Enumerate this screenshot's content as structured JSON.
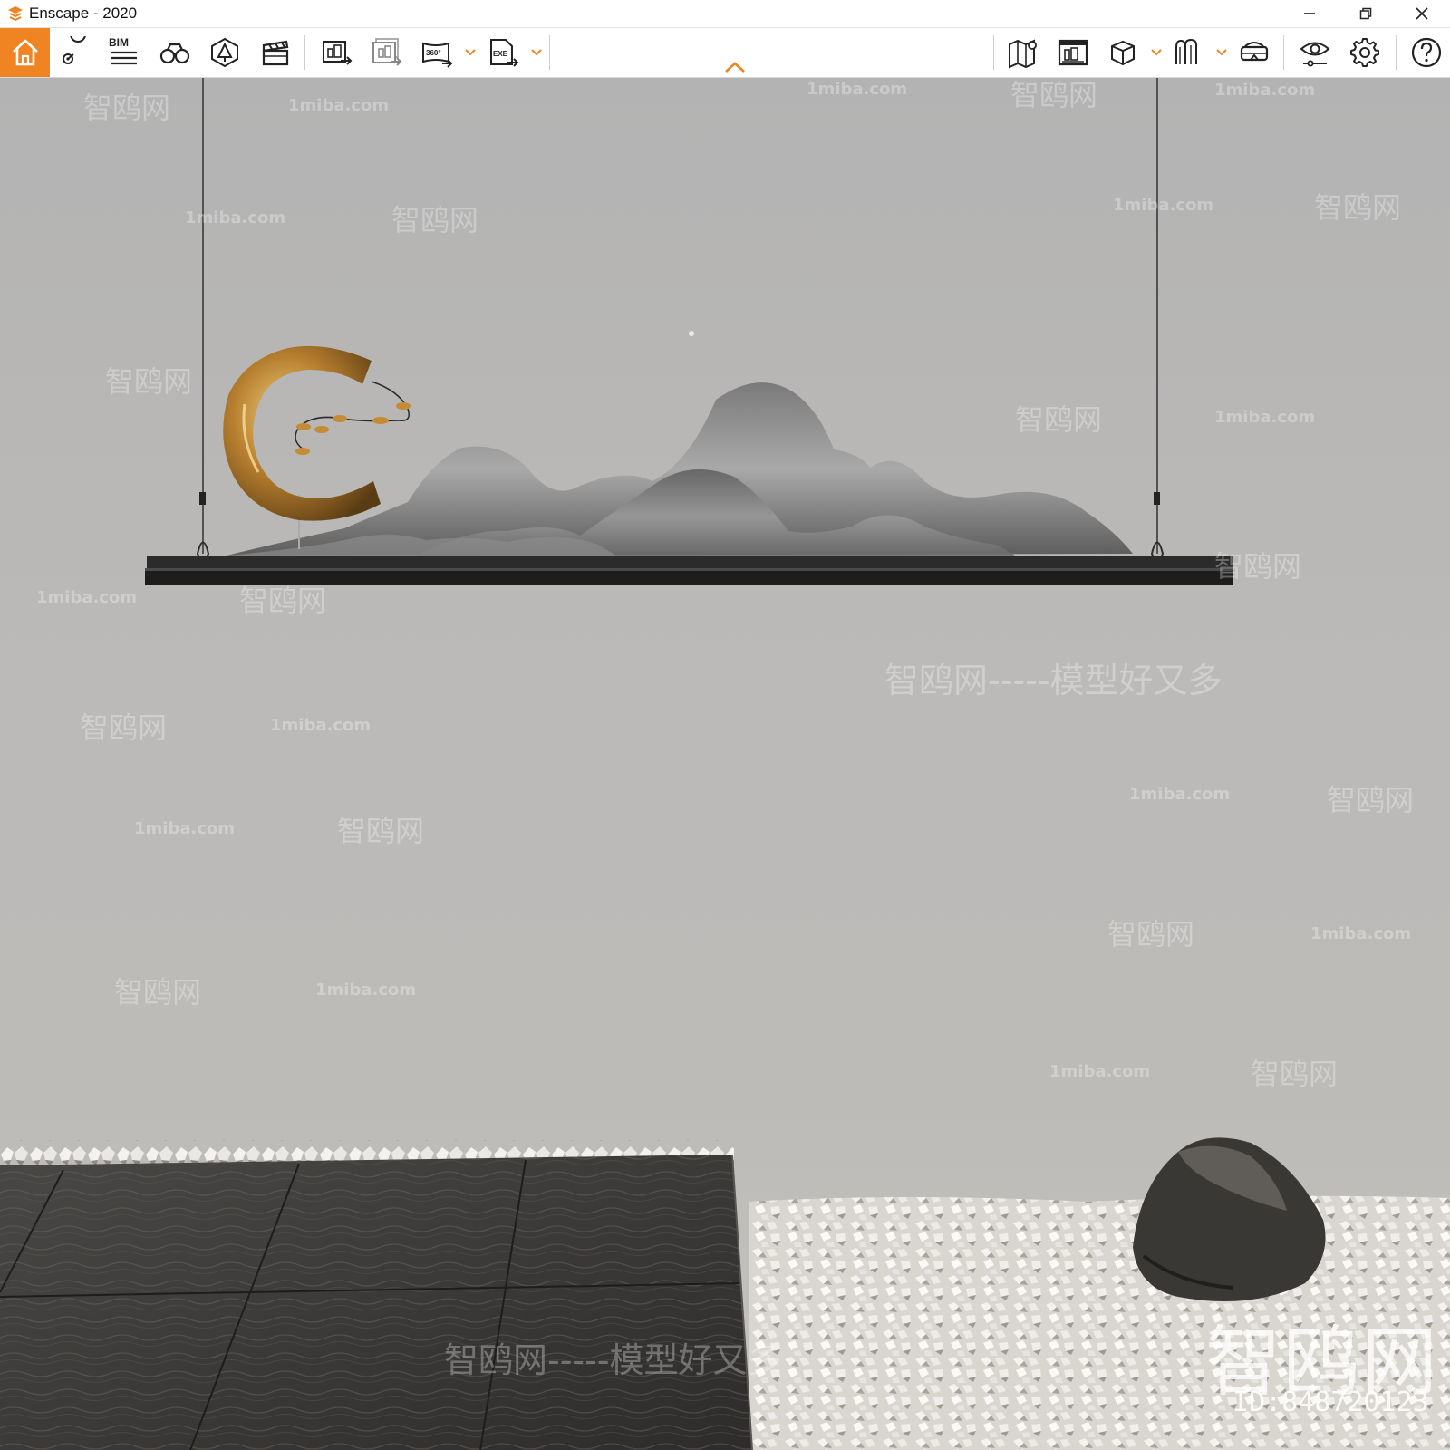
{
  "window": {
    "title": "Enscape - 2020",
    "controls": {
      "minimize": "—",
      "restore": "⧉",
      "close": "✕"
    }
  },
  "toolbar": {
    "accent_color": "#f08322",
    "bim_label": "BIM",
    "buttons": [
      {
        "name": "home",
        "icon": "home-icon"
      },
      {
        "name": "views",
        "icon": "map-pin-icon"
      },
      {
        "name": "bim",
        "icon": "bim-list-icon"
      },
      {
        "name": "walk-mode",
        "icon": "binoculars-icon"
      },
      {
        "name": "assets",
        "icon": "tree-asset-icon"
      },
      {
        "name": "video-editor",
        "icon": "clapperboard-icon"
      },
      {
        "name": "screenshot",
        "icon": "screenshot-export-icon"
      },
      {
        "name": "batch-render",
        "icon": "batch-render-icon"
      },
      {
        "name": "panorama-360",
        "icon": "panorama-360-icon"
      },
      {
        "name": "exe-export",
        "icon": "exe-export-icon"
      },
      {
        "name": "map",
        "icon": "map-icon"
      },
      {
        "name": "render-gallery",
        "icon": "render-gallery-icon"
      },
      {
        "name": "view-cube",
        "icon": "cube-icon"
      },
      {
        "name": "material-editor",
        "icon": "material-icon"
      },
      {
        "name": "vr-headset",
        "icon": "vr-headset-icon"
      },
      {
        "name": "visual-settings",
        "icon": "eye-settings-icon"
      },
      {
        "name": "general-settings",
        "icon": "gear-icon"
      },
      {
        "name": "help",
        "icon": "help-icon"
      }
    ],
    "panorama_text": "360°",
    "exe_text": "EXE"
  },
  "viewport": {
    "watermarks": {
      "url": "1miba.com",
      "site": "智鸥网",
      "slogan": "智鸥网-----模型好又多",
      "dashes": "------",
      "brand": "智鸥网",
      "id": "ID:848720123"
    }
  }
}
